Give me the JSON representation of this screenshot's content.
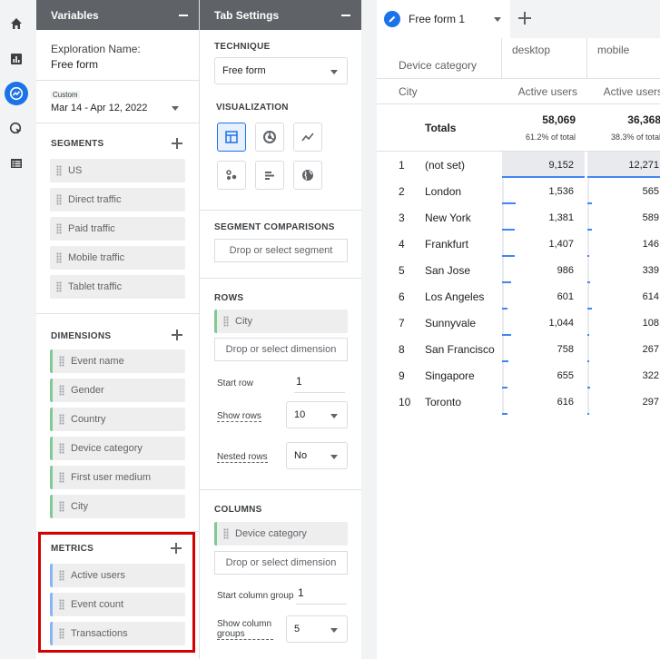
{
  "rail": [
    "home-icon",
    "bar-chart-icon",
    "explore-icon",
    "advertising-icon",
    "list-icon"
  ],
  "variables": {
    "header": "Variables",
    "exploration_label": "Exploration Name:",
    "exploration_name": "Free form",
    "date_custom": "Custom",
    "date_range": "Mar 14 - Apr 12, 2022",
    "segments_title": "SEGMENTS",
    "segments": [
      "US",
      "Direct traffic",
      "Paid traffic",
      "Mobile traffic",
      "Tablet traffic"
    ],
    "dimensions_title": "DIMENSIONS",
    "dimensions": [
      "Event name",
      "Gender",
      "Country",
      "Device category",
      "First user medium",
      "City"
    ],
    "metrics_title": "METRICS",
    "metrics": [
      "Active users",
      "Event count",
      "Transactions"
    ],
    "highlight_color": "#d50000"
  },
  "tab_settings": {
    "header": "Tab Settings",
    "technique_title": "TECHNIQUE",
    "technique": "Free form",
    "visualization_title": "VISUALIZATION",
    "viz_icons": [
      "table-icon",
      "donut-chart-icon",
      "line-chart-icon",
      "scatter-plot-icon",
      "bar-chart-icon",
      "geo-map-icon"
    ],
    "segment_comparisons_title": "SEGMENT COMPARISONS",
    "segment_drop": "Drop or select segment",
    "rows_title": "ROWS",
    "row_chip": "City",
    "row_drop": "Drop or select dimension",
    "start_row_label": "Start row",
    "start_row": "1",
    "show_rows_label": "Show rows",
    "show_rows": "10",
    "nested_rows_label": "Nested rows",
    "nested_rows": "No",
    "columns_title": "COLUMNS",
    "col_chip": "Device category",
    "col_drop": "Drop or select dimension",
    "start_col_label": "Start column group",
    "start_col": "1",
    "show_col_label": "Show column groups",
    "show_col": "5"
  },
  "canvas": {
    "tab_name": "Free form 1",
    "dimension_header": "Device category",
    "row_dimension": "City",
    "columns": [
      {
        "name": "desktop",
        "metric": "Active users",
        "total": "58,069",
        "pct": "61.2% of total"
      },
      {
        "name": "mobile",
        "metric": "Active users",
        "total": "36,368",
        "pct": "38.3% of total"
      }
    ],
    "totals_label": "Totals",
    "rows": [
      {
        "n": "1",
        "city": "(not set)",
        "desktop": "9,152",
        "mobile": "12,271",
        "d_frac": 1.0,
        "m_frac": 1.0
      },
      {
        "n": "2",
        "city": "London",
        "desktop": "1,536",
        "mobile": "565",
        "d_frac": 0.17,
        "m_frac": 0.05
      },
      {
        "n": "3",
        "city": "New York",
        "desktop": "1,381",
        "mobile": "589",
        "d_frac": 0.15,
        "m_frac": 0.05
      },
      {
        "n": "4",
        "city": "Frankfurt",
        "desktop": "1,407",
        "mobile": "146",
        "d_frac": 0.15,
        "m_frac": 0.01
      },
      {
        "n": "5",
        "city": "San Jose",
        "desktop": "986",
        "mobile": "339",
        "d_frac": 0.11,
        "m_frac": 0.03
      },
      {
        "n": "6",
        "city": "Los Angeles",
        "desktop": "601",
        "mobile": "614",
        "d_frac": 0.07,
        "m_frac": 0.05
      },
      {
        "n": "7",
        "city": "Sunnyvale",
        "desktop": "1,044",
        "mobile": "108",
        "d_frac": 0.11,
        "m_frac": 0.01
      },
      {
        "n": "8",
        "city": "San Francisco",
        "desktop": "758",
        "mobile": "267",
        "d_frac": 0.08,
        "m_frac": 0.02
      },
      {
        "n": "9",
        "city": "Singapore",
        "desktop": "655",
        "mobile": "322",
        "d_frac": 0.07,
        "m_frac": 0.03
      },
      {
        "n": "10",
        "city": "Toronto",
        "desktop": "616",
        "mobile": "297",
        "d_frac": 0.07,
        "m_frac": 0.02
      }
    ]
  }
}
